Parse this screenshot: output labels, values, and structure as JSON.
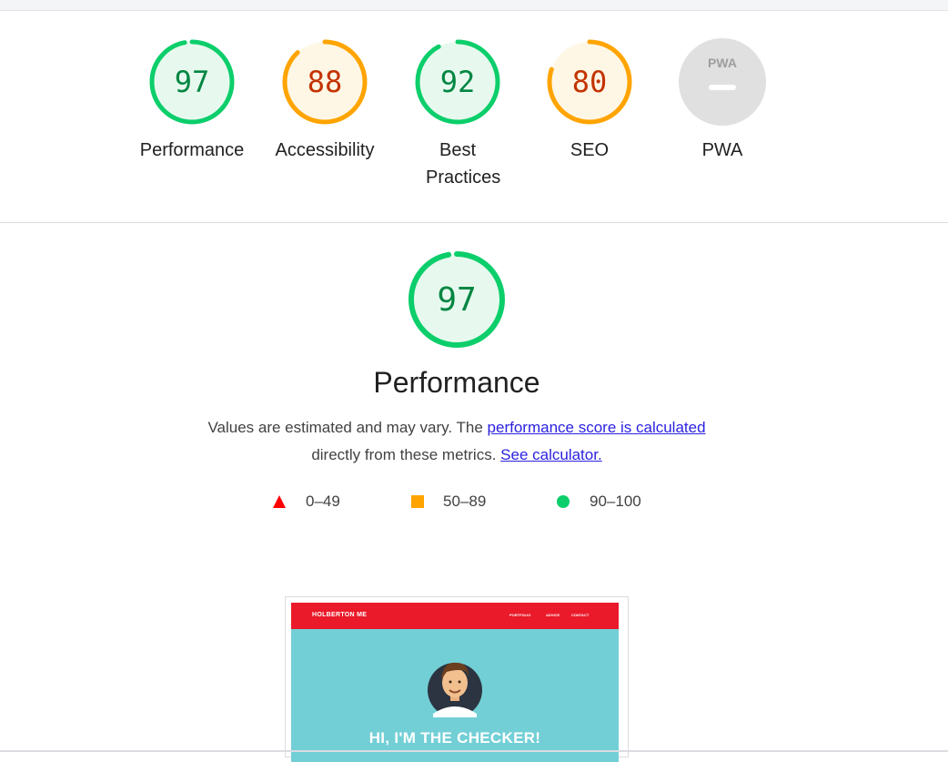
{
  "gauges": [
    {
      "id": "performance",
      "score": "97",
      "label": "Performance",
      "fraction": 0.97,
      "status": "pass"
    },
    {
      "id": "accessibility",
      "score": "88",
      "label": "Accessibility",
      "fraction": 0.88,
      "status": "average"
    },
    {
      "id": "best-practices",
      "score": "92",
      "label": "Best Practices",
      "fraction": 0.92,
      "status": "pass"
    },
    {
      "id": "seo",
      "score": "80",
      "label": "SEO",
      "fraction": 0.8,
      "status": "average"
    },
    {
      "id": "pwa",
      "badge": "PWA",
      "label": "PWA",
      "status": "na"
    }
  ],
  "colors": {
    "pass": "#0cce6b",
    "pass_text": "#018642",
    "pass_fill": "#e7f9ee",
    "average": "#ffa400",
    "average_text": "#c33300",
    "average_fill": "#fff7e6",
    "fail": "#ff4e42",
    "na_fill": "#e0e0e0",
    "link": "#2c22e0"
  },
  "performance": {
    "score": "97",
    "fraction": 0.97,
    "title": "Performance",
    "desc_prefix": "Values are estimated and may vary. The",
    "desc_link1": "performance score is calculated",
    "desc_middle": "directly from these metrics.",
    "desc_link2": "See calculator."
  },
  "legend": [
    {
      "shape": "triangle",
      "range": "0–49",
      "color": "#ff0000"
    },
    {
      "shape": "square",
      "range": "50–89",
      "color": "#ffa400"
    },
    {
      "shape": "circle",
      "range": "90–100",
      "color": "#0cce6b"
    }
  ],
  "screenshot": {
    "brand": "HOLBERTON ME",
    "nav_links": [
      "PORTFOLIO",
      "ADVICE",
      "CONTACT"
    ],
    "heading": "HI, I'M THE CHECKER!"
  }
}
